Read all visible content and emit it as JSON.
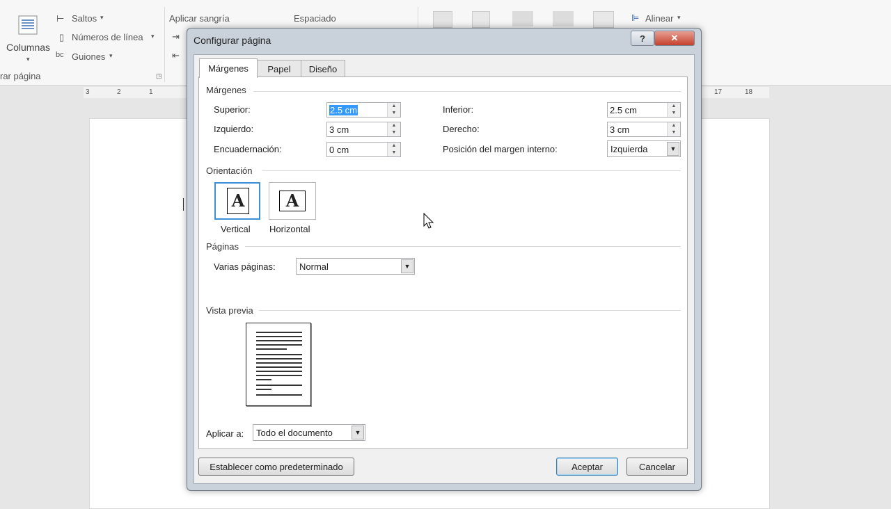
{
  "ribbon": {
    "columns_label": "Columnas",
    "breaks_label": "Saltos",
    "line_numbers_label": "Números de línea",
    "hyphenation_label": "Guiones",
    "group_label": "rar página",
    "indent_label": "Aplicar sangría",
    "spacing_label": "Espaciado",
    "align_label": "Alinear"
  },
  "ruler": {
    "ticks_left": [
      "3",
      "2",
      "1"
    ],
    "ticks_right": [
      "17",
      "18"
    ]
  },
  "dialog": {
    "title": "Configurar página",
    "help": "?",
    "close": "✕",
    "tabs": [
      "Márgenes",
      "Papel",
      "Diseño"
    ],
    "margins_section": "Márgenes",
    "fields": {
      "top_label": "Superior:",
      "top_value": "2.5 cm",
      "left_label": "Izquierdo:",
      "left_value": "3 cm",
      "gutter_label": "Encuadernación:",
      "gutter_value": "0 cm",
      "bottom_label": "Inferior:",
      "bottom_value": "2.5 cm",
      "right_label": "Derecho:",
      "right_value": "3 cm",
      "gutter_pos_label": "Posición del margen interno:",
      "gutter_pos_value": "Izquierda"
    },
    "orientation_section": "Orientación",
    "orientation": {
      "portrait_label": "Vertical",
      "landscape_label": "Horizontal",
      "glyph": "A",
      "selected": "portrait"
    },
    "pages_section": "Páginas",
    "multiple_pages_label": "Varias páginas:",
    "multiple_pages_value": "Normal",
    "preview_section": "Vista previa",
    "apply_to_label": "Aplicar a:",
    "apply_to_value": "Todo el documento",
    "set_default_button": "Establecer como predeterminado",
    "ok_button": "Aceptar",
    "cancel_button": "Cancelar"
  },
  "colors": {
    "selection": "#3399ff",
    "dialog_frame": "#c9d1da",
    "orientation_selected": "#3c8fd6"
  }
}
